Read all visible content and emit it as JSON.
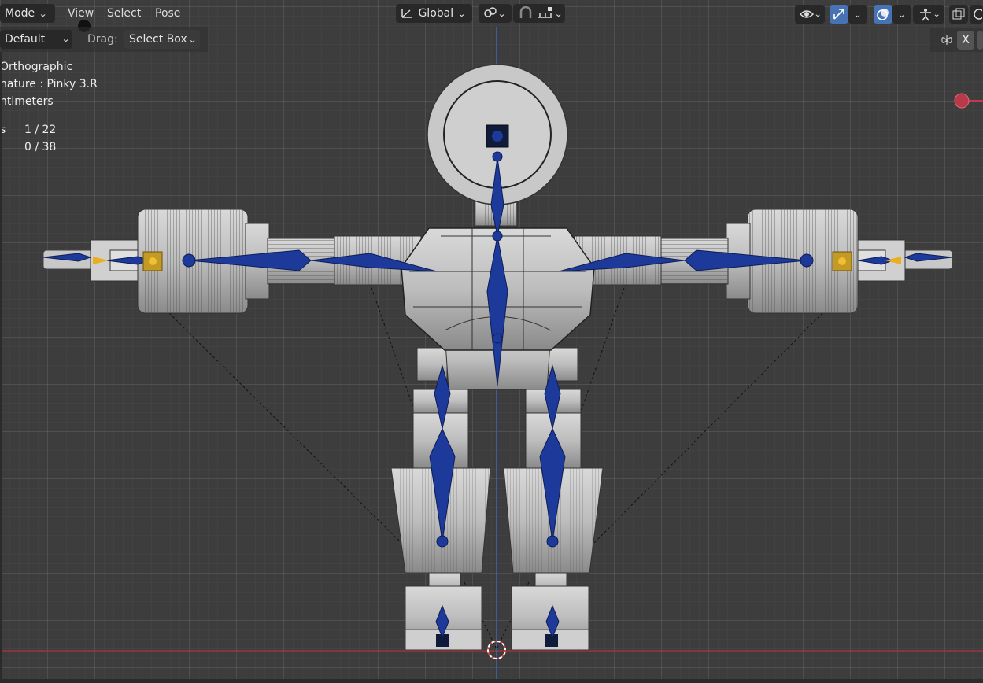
{
  "header": {
    "mode_label": "Mode",
    "menu": [
      "View",
      "Select",
      "Pose"
    ],
    "transform_orientation": "Global"
  },
  "toolbar": {
    "transform_pivot": "Default",
    "drag_label": "Drag:",
    "drag_value": "Select Box"
  },
  "overlay_info": {
    "view_name": "Orthographic",
    "active_object": "nature : Pinky 3.R",
    "units": "ntimeters",
    "stats_label": "s",
    "bones_selected": "1 / 22",
    "objects_selected": "0 / 38"
  },
  "gizmo": {
    "x_axis_label": "X"
  },
  "colors": {
    "viewport_bg": "#3d3d3d",
    "bone_blue": "#1d3a9a",
    "bone_selected": "#e8b020",
    "active_button": "#4772b3",
    "x_axis_red": "#c0394d"
  }
}
